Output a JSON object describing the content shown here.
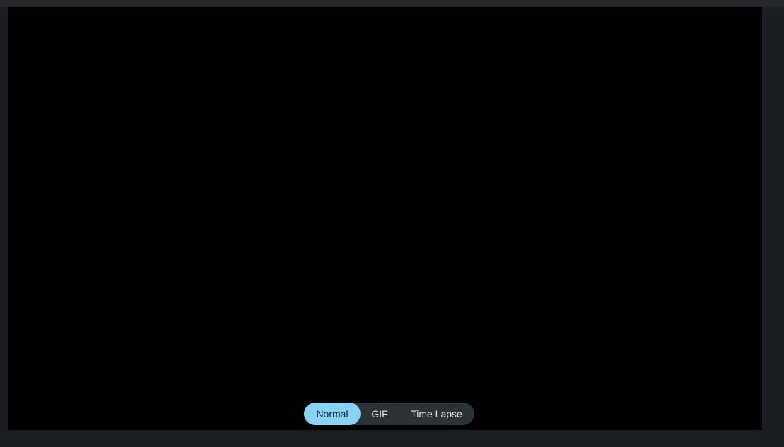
{
  "modes": {
    "items": [
      {
        "label": "Normal",
        "active": true
      },
      {
        "label": "GIF",
        "active": false
      },
      {
        "label": "Time Lapse",
        "active": false
      }
    ]
  },
  "colors": {
    "background": "#1b1d20",
    "viewfinder": "#000000",
    "mode_bar": "#2a3238",
    "active_mode": "#8ad2f5"
  }
}
